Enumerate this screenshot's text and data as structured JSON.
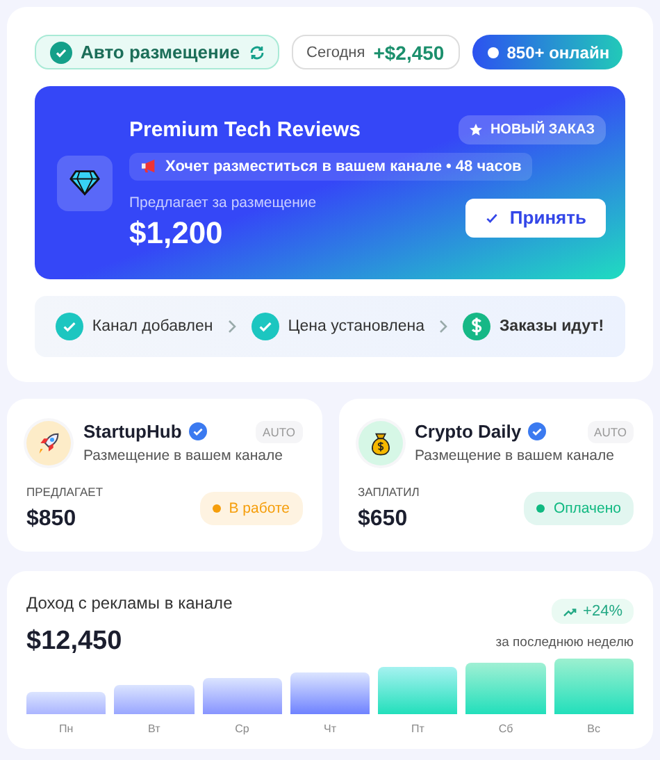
{
  "top_bar": {
    "auto_placement": {
      "label": "Авто размещение",
      "on": true
    },
    "today": {
      "label": "Сегодня",
      "value": "+$2,450"
    },
    "online": {
      "label": "850+ онлайн"
    }
  },
  "offer": {
    "title": "Premium Tech Reviews",
    "badge": "НОВЫЙ ЗАКАЗ",
    "note": "Хочет разместиться в вашем канале • 48 часов",
    "price_label": "Предлагает за размещение",
    "price": "$1,200",
    "accept_button": "Принять"
  },
  "steps": [
    {
      "label": "Канал добавлен",
      "kind": "check"
    },
    {
      "label": "Цена установлена",
      "kind": "check"
    },
    {
      "label": "Заказы идут!",
      "kind": "money"
    }
  ],
  "orders": [
    {
      "name": "StartupHub",
      "kind": "rocket",
      "verified": true,
      "subtitle": "Размещение в вашем канале",
      "tag": "AUTO",
      "amount_label": "ПРЕДЛАГАЕТ",
      "amount": "$850",
      "status": {
        "label": "В работе",
        "color": "#f59e0b"
      }
    },
    {
      "name": "Crypto Daily",
      "kind": "bag",
      "verified": true,
      "subtitle": "Размещение в вашем канале",
      "tag": "AUTO",
      "amount_label": "ЗАПЛАТИЛ",
      "amount": "$650",
      "status": {
        "label": "Оплачено",
        "color": "#10b981"
      }
    }
  ],
  "revenue": {
    "title": "Доход с рекламы в канале",
    "total": "$12,450",
    "change": "+24%",
    "period": "за последнюю неделю",
    "days": [
      "Пн",
      "Вт",
      "Ср",
      "Чт",
      "Пт",
      "Сб",
      "Вс"
    ]
  }
}
